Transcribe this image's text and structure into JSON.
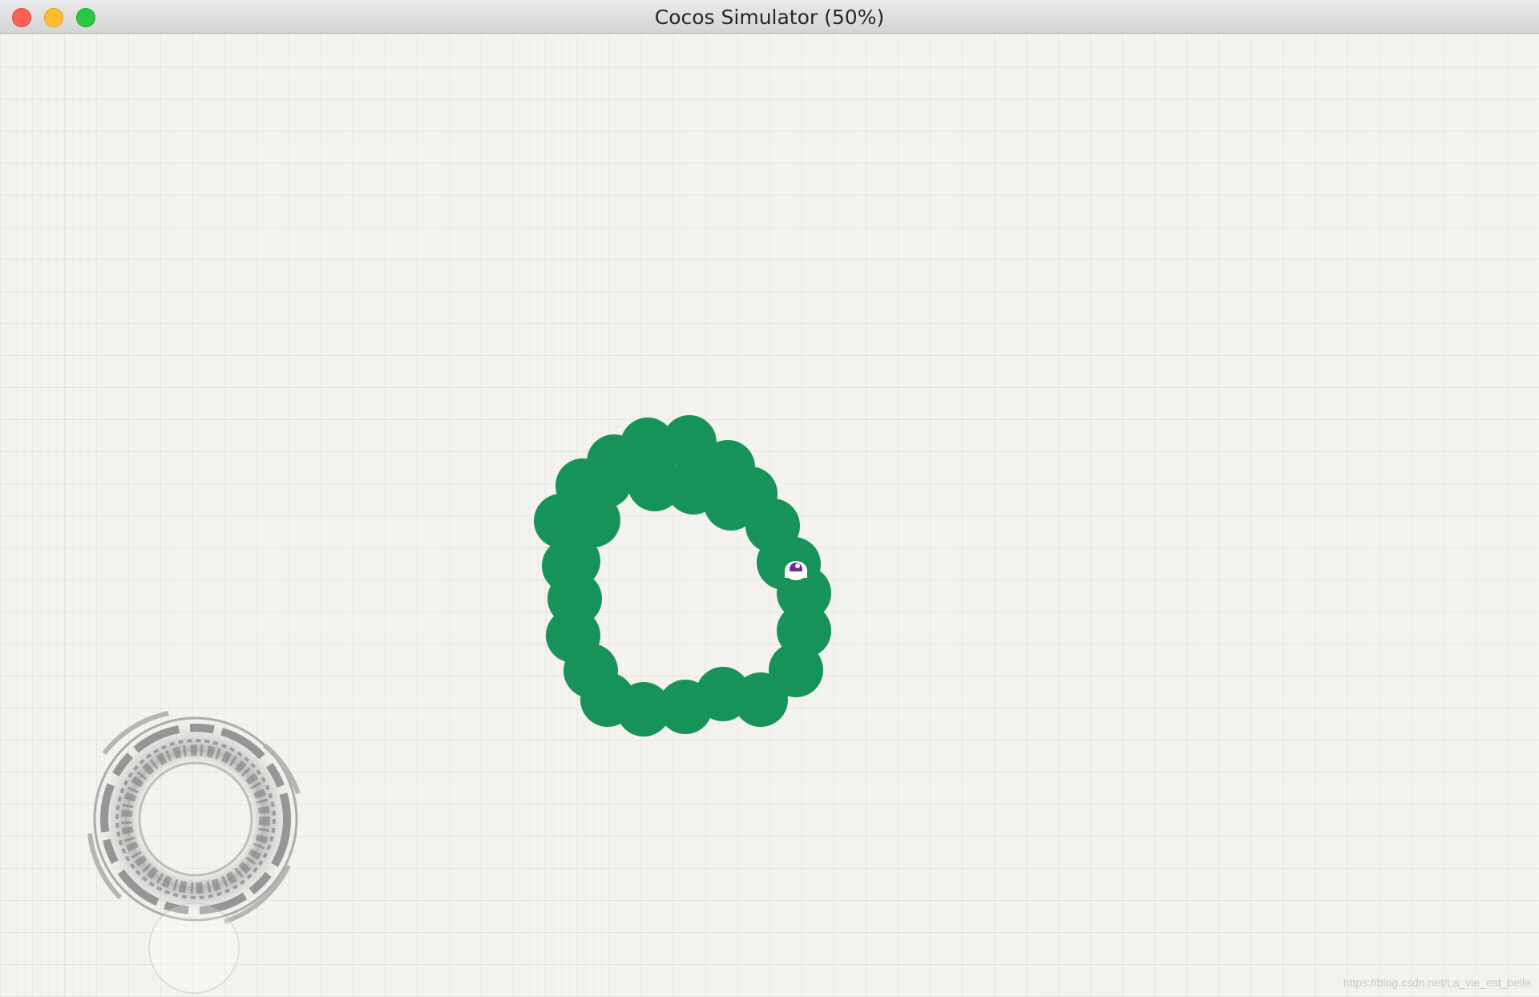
{
  "window": {
    "title": "Cocos Simulator (50%)"
  },
  "game": {
    "snake_color": "#17935a",
    "eye_color": "#6a2c91",
    "joystick_icon": "joystick-rune-ring"
  },
  "watermark": {
    "text": "https://blog.csdn.net/La_vie_est_belle"
  }
}
